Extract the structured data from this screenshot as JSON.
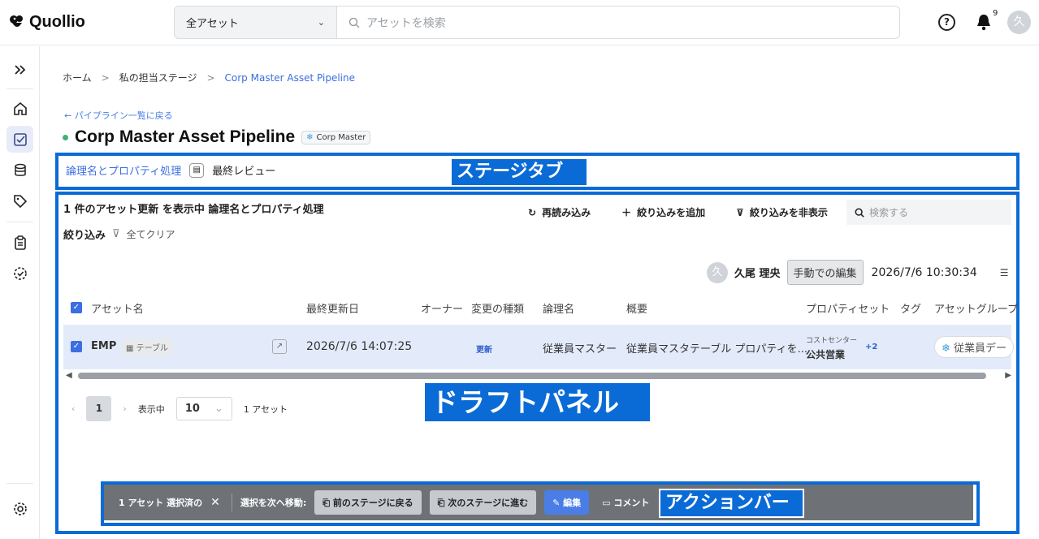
{
  "header": {
    "logo_text": "Quollio",
    "scope_select": "全アセット",
    "search_placeholder": "アセットを検索",
    "notification_count": "9",
    "user_initial": "久"
  },
  "breadcrumb": {
    "items": [
      "ホーム",
      "私の担当ステージ",
      "Corp Master Asset Pipeline"
    ]
  },
  "back_link": "← パイプライン一覧に戻る",
  "page": {
    "title": "Corp Master Asset Pipeline",
    "badge": "Corp Master",
    "status_color": "#3cb371"
  },
  "stage_tabs": {
    "tab_label": "論理名とプロパティ処理",
    "tab_badge": "最終レビュー"
  },
  "draft_panel": {
    "summary": "1 件のアセット更新 を表示中 論理名とプロパティ処理",
    "tools": {
      "reload": "再読み込み",
      "add_filter": "絞り込みを追加",
      "hide_filter": "絞り込みを非表示"
    },
    "search_placeholder": "検索する",
    "filter_label": "絞り込み",
    "clear_all": "全てクリア",
    "editor": {
      "initial": "久",
      "name": "久尾 理央",
      "mode": "手動での編集",
      "datetime": "2026/7/6 10:30:34"
    },
    "columns": [
      "アセット名",
      "最終更新日",
      "オーナー",
      "変更の種類",
      "論理名",
      "概要",
      "プロパティセット",
      "タグ",
      "アセットグループ"
    ],
    "rows": [
      {
        "asset_name": "EMP",
        "asset_type": "テーブル",
        "last_updated": "2026/7/6 14:07:25",
        "change_type": "更新",
        "logical_name": "従業員マスター",
        "summary": "従業員マスタテーブル プロパティを...",
        "property_key": "コストセンター",
        "property_value": "公共営業",
        "property_more": "+2",
        "asset_group": "従業員デー"
      }
    ],
    "pagination": {
      "current_page": "1",
      "per_page_label": "表示中",
      "per_page": "10",
      "total": "1 アセット"
    }
  },
  "action_bar": {
    "selected": "1 アセット 選択済の",
    "move_label": "選択を次へ移動:",
    "prev_stage": "前のステージに戻る",
    "next_stage": "次のステージに進む",
    "edit": "編集",
    "comment": "コメント"
  },
  "annotations": {
    "stage_tab_label": "ステージタブ",
    "draft_panel_label": "ドラフトパネル",
    "action_bar_label": "アクションバー",
    "frame_color": "#0b6bd6"
  }
}
